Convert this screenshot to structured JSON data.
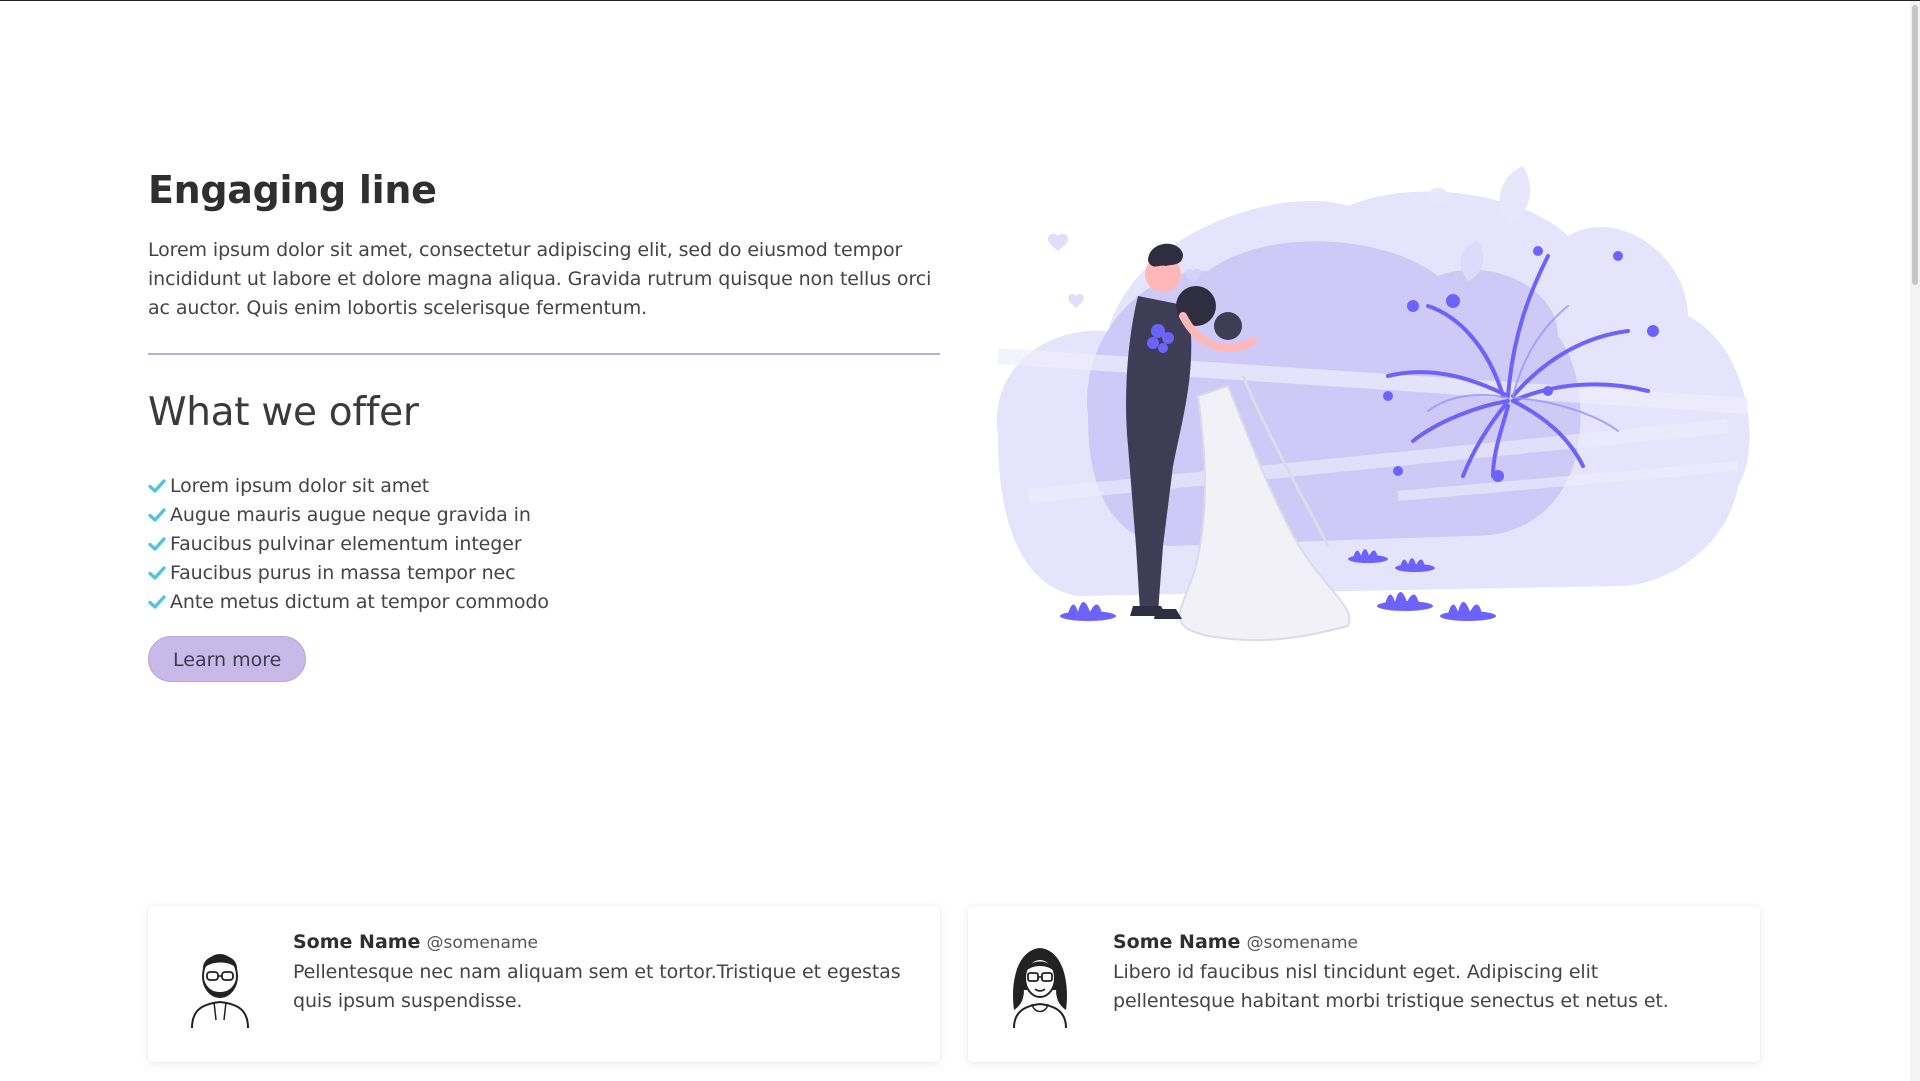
{
  "hero": {
    "title": "Engaging line",
    "intro": "Lorem ipsum dolor sit amet, consectetur adipiscing elit, sed do eiusmod tempor incididunt ut labore et dolore magna aliqua. Gravida rutrum quisque non tellus orci ac auctor. Quis enim lobortis scelerisque fermentum.",
    "offer_title": "What we offer",
    "offers": [
      "Lorem ipsum dolor sit amet",
      "Augue mauris augue neque gravida in",
      "Faucibus pulvinar elementum integer",
      "Faucibus purus in massa tempor nec",
      "Ante metus dictum at tempor commodo"
    ],
    "button_label": "Learn more",
    "check_icon": "check-icon",
    "illustration_icon": "wedding-couple-illustration"
  },
  "testimonials": [
    {
      "name": "Some Name",
      "handle": "@somename",
      "text": "Pellentesque nec nam aliquam sem et tortor.Tristique et egestas quis ipsum suspendisse.",
      "avatar_icon": "bearded-man-avatar-icon"
    },
    {
      "name": "Some Name",
      "handle": "@somename",
      "text": "Libero id faucibus nisl tincidunt eget. Adipiscing elit pellentesque habitant morbi tristique senectus et netus et.",
      "avatar_icon": "woman-avatar-icon"
    }
  ],
  "colors": {
    "accent": "#c9b9e8",
    "check": "#4fc3e0",
    "illustration_light": "#e4e0fb",
    "illustration_mid": "#cdc7f7",
    "illustration_strong": "#6c63ff"
  }
}
